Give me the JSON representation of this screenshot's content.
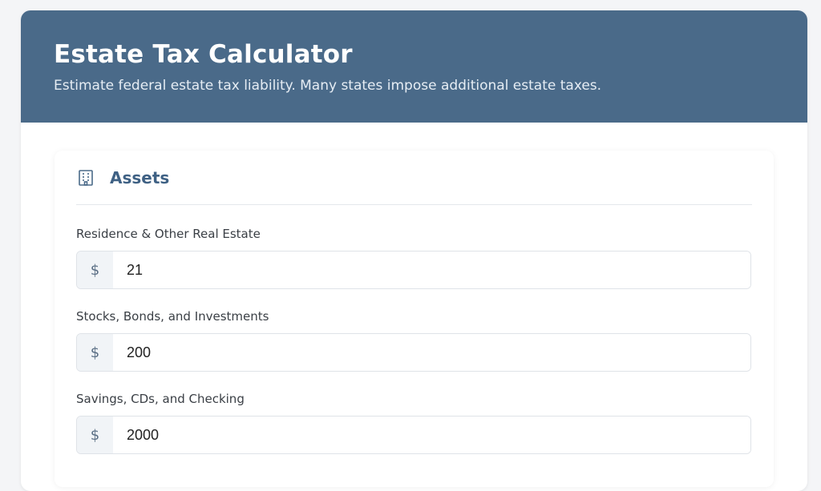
{
  "header": {
    "title": "Estate Tax Calculator",
    "subtitle": "Estimate federal estate tax liability. Many states impose additional estate taxes."
  },
  "assets": {
    "title": "Assets",
    "icon": "building-icon",
    "fields": [
      {
        "label": "Residence & Other Real Estate",
        "prefix": "$",
        "value": "21"
      },
      {
        "label": "Stocks, Bonds, and Investments",
        "prefix": "$",
        "value": "200"
      },
      {
        "label": "Savings, CDs, and Checking",
        "prefix": "$",
        "value": "2000"
      }
    ]
  },
  "colors": {
    "header_bg": "#4a6a89",
    "accent": "#3f6184"
  }
}
